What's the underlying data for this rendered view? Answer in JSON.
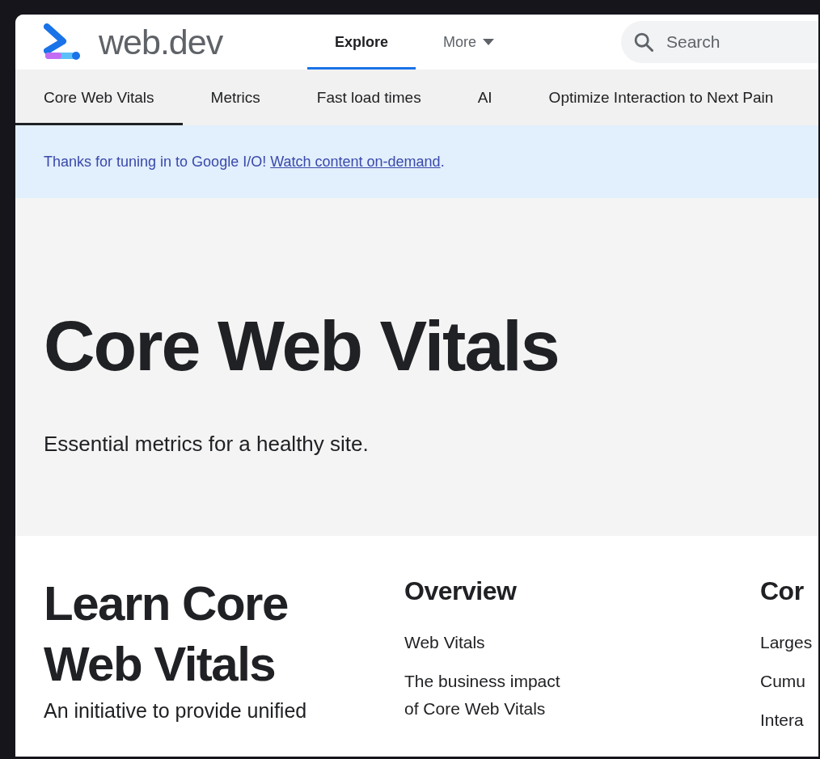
{
  "header": {
    "logo_text": "web.dev",
    "nav": [
      {
        "label": "Explore",
        "kind": "link",
        "selected": true
      },
      {
        "label": "More",
        "kind": "dropdown",
        "selected": false
      }
    ],
    "search": {
      "placeholder": "Search"
    }
  },
  "tabs": [
    {
      "label": "Core Web Vitals",
      "selected": true
    },
    {
      "label": "Metrics",
      "selected": false
    },
    {
      "label": "Fast load times",
      "selected": false
    },
    {
      "label": "AI",
      "selected": false
    },
    {
      "label": "Optimize Interaction to Next Pain",
      "selected": false
    }
  ],
  "banner": {
    "text": "Thanks for tuning in to Google I/O!",
    "link": "Watch content on-demand",
    "suffix": "."
  },
  "hero": {
    "title": "Core Web Vitals",
    "subtitle": "Essential metrics for a healthy site."
  },
  "learn": {
    "title": "Learn Core Web Vitals",
    "description": "An initiative to provide unified"
  },
  "columns": [
    {
      "heading": "Overview",
      "links": [
        "Web Vitals",
        "The business impact of Core Web Vitals"
      ]
    },
    {
      "heading": "Cor",
      "links": [
        "Larges",
        "Cumu",
        "Intera"
      ]
    }
  ]
}
